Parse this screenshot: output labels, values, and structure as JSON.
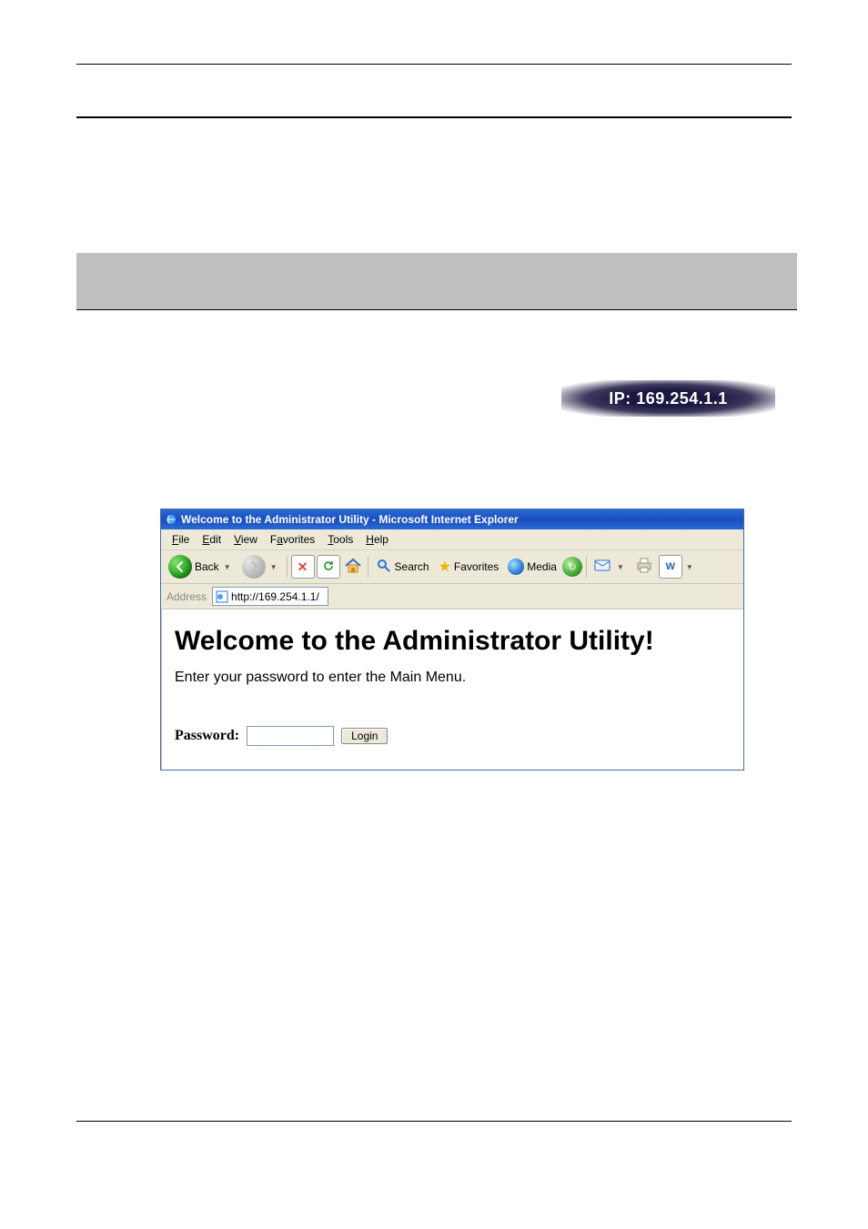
{
  "ip_badge": {
    "text": "IP: 169.254.1.1"
  },
  "browser": {
    "title": "Welcome to the Administrator Utility - Microsoft Internet Explorer",
    "menu": {
      "file": "File",
      "edit": "Edit",
      "view": "View",
      "favorites": "Favorites",
      "tools": "Tools",
      "help": "Help"
    },
    "toolbar": {
      "back": "Back",
      "search": "Search",
      "favorites": "Favorites",
      "media": "Media"
    },
    "address": {
      "label": "Address",
      "url": "http://169.254.1.1/"
    },
    "page": {
      "heading": "Welcome to the Administrator Utility!",
      "prompt": "Enter your password to enter the Main Menu.",
      "password_label": "Password:",
      "login_button": "Login"
    }
  }
}
